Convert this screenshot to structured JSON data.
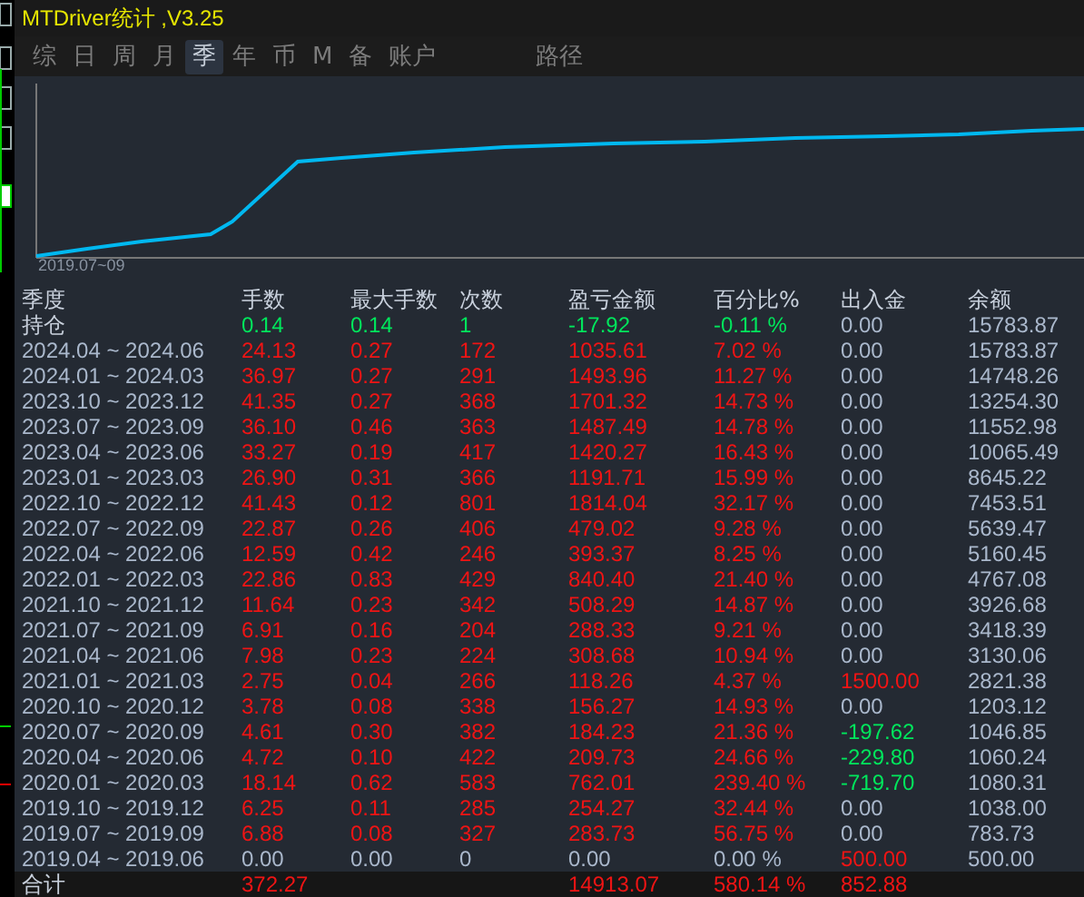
{
  "window": {
    "title": "MTDriver统计 ,V3.25"
  },
  "tabs": [
    {
      "label": "综",
      "selected": false
    },
    {
      "label": "日",
      "selected": false
    },
    {
      "label": "周",
      "selected": false
    },
    {
      "label": "月",
      "selected": false
    },
    {
      "label": "季",
      "selected": true
    },
    {
      "label": "年",
      "selected": false
    },
    {
      "label": "币",
      "selected": false
    },
    {
      "label": "M",
      "selected": false
    },
    {
      "label": "备",
      "selected": false
    },
    {
      "label": "账户",
      "selected": false
    }
  ],
  "path_tab": {
    "label": "路径"
  },
  "chart": {
    "start_label": "2019.07~09"
  },
  "table": {
    "columns": [
      "季度",
      "手数",
      "最大手数",
      "次数",
      "盈亏金额",
      "百分比%",
      "出入金",
      "余额"
    ],
    "rows": [
      [
        {
          "text": "持仓",
          "color": "#c8d0dc"
        },
        {
          "text": "0.14",
          "color": "#00e65c"
        },
        {
          "text": "0.14",
          "color": "#00e65c"
        },
        {
          "text": "1",
          "color": "#00e65c"
        },
        {
          "text": "-17.92",
          "color": "#00e65c"
        },
        {
          "text": "-0.11 %",
          "color": "#00e65c"
        },
        {
          "text": "0.00",
          "color": "#aab8cc"
        },
        {
          "text": "15783.87",
          "color": "#aab8cc"
        }
      ],
      [
        {
          "text": "2024.04 ~ 2024.06",
          "color": "#aab8cc"
        },
        {
          "text": "24.13",
          "color": "#f01414"
        },
        {
          "text": "0.27",
          "color": "#f01414"
        },
        {
          "text": "172",
          "color": "#f01414"
        },
        {
          "text": "1035.61",
          "color": "#f01414"
        },
        {
          "text": "7.02 %",
          "color": "#f01414"
        },
        {
          "text": "0.00",
          "color": "#aab8cc"
        },
        {
          "text": "15783.87",
          "color": "#aab8cc"
        }
      ],
      [
        {
          "text": "2024.01 ~ 2024.03",
          "color": "#aab8cc"
        },
        {
          "text": "36.97",
          "color": "#f01414"
        },
        {
          "text": "0.27",
          "color": "#f01414"
        },
        {
          "text": "291",
          "color": "#f01414"
        },
        {
          "text": "1493.96",
          "color": "#f01414"
        },
        {
          "text": "11.27 %",
          "color": "#f01414"
        },
        {
          "text": "0.00",
          "color": "#aab8cc"
        },
        {
          "text": "14748.26",
          "color": "#aab8cc"
        }
      ],
      [
        {
          "text": "2023.10 ~ 2023.12",
          "color": "#aab8cc"
        },
        {
          "text": "41.35",
          "color": "#f01414"
        },
        {
          "text": "0.27",
          "color": "#f01414"
        },
        {
          "text": "368",
          "color": "#f01414"
        },
        {
          "text": "1701.32",
          "color": "#f01414"
        },
        {
          "text": "14.73 %",
          "color": "#f01414"
        },
        {
          "text": "0.00",
          "color": "#aab8cc"
        },
        {
          "text": "13254.30",
          "color": "#aab8cc"
        }
      ],
      [
        {
          "text": "2023.07 ~ 2023.09",
          "color": "#aab8cc"
        },
        {
          "text": "36.10",
          "color": "#f01414"
        },
        {
          "text": "0.46",
          "color": "#f01414"
        },
        {
          "text": "363",
          "color": "#f01414"
        },
        {
          "text": "1487.49",
          "color": "#f01414"
        },
        {
          "text": "14.78 %",
          "color": "#f01414"
        },
        {
          "text": "0.00",
          "color": "#aab8cc"
        },
        {
          "text": "11552.98",
          "color": "#aab8cc"
        }
      ],
      [
        {
          "text": "2023.04 ~ 2023.06",
          "color": "#aab8cc"
        },
        {
          "text": "33.27",
          "color": "#f01414"
        },
        {
          "text": "0.19",
          "color": "#f01414"
        },
        {
          "text": "417",
          "color": "#f01414"
        },
        {
          "text": "1420.27",
          "color": "#f01414"
        },
        {
          "text": "16.43 %",
          "color": "#f01414"
        },
        {
          "text": "0.00",
          "color": "#aab8cc"
        },
        {
          "text": "10065.49",
          "color": "#aab8cc"
        }
      ],
      [
        {
          "text": "2023.01 ~ 2023.03",
          "color": "#aab8cc"
        },
        {
          "text": "26.90",
          "color": "#f01414"
        },
        {
          "text": "0.31",
          "color": "#f01414"
        },
        {
          "text": "366",
          "color": "#f01414"
        },
        {
          "text": "1191.71",
          "color": "#f01414"
        },
        {
          "text": "15.99 %",
          "color": "#f01414"
        },
        {
          "text": "0.00",
          "color": "#aab8cc"
        },
        {
          "text": "8645.22",
          "color": "#aab8cc"
        }
      ],
      [
        {
          "text": "2022.10 ~ 2022.12",
          "color": "#aab8cc"
        },
        {
          "text": "41.43",
          "color": "#f01414"
        },
        {
          "text": "0.12",
          "color": "#f01414"
        },
        {
          "text": "801",
          "color": "#f01414"
        },
        {
          "text": "1814.04",
          "color": "#f01414"
        },
        {
          "text": "32.17 %",
          "color": "#f01414"
        },
        {
          "text": "0.00",
          "color": "#aab8cc"
        },
        {
          "text": "7453.51",
          "color": "#aab8cc"
        }
      ],
      [
        {
          "text": "2022.07 ~ 2022.09",
          "color": "#aab8cc"
        },
        {
          "text": "22.87",
          "color": "#f01414"
        },
        {
          "text": "0.26",
          "color": "#f01414"
        },
        {
          "text": "406",
          "color": "#f01414"
        },
        {
          "text": "479.02",
          "color": "#f01414"
        },
        {
          "text": "9.28 %",
          "color": "#f01414"
        },
        {
          "text": "0.00",
          "color": "#aab8cc"
        },
        {
          "text": "5639.47",
          "color": "#aab8cc"
        }
      ],
      [
        {
          "text": "2022.04 ~ 2022.06",
          "color": "#aab8cc"
        },
        {
          "text": "12.59",
          "color": "#f01414"
        },
        {
          "text": "0.42",
          "color": "#f01414"
        },
        {
          "text": "246",
          "color": "#f01414"
        },
        {
          "text": "393.37",
          "color": "#f01414"
        },
        {
          "text": "8.25 %",
          "color": "#f01414"
        },
        {
          "text": "0.00",
          "color": "#aab8cc"
        },
        {
          "text": "5160.45",
          "color": "#aab8cc"
        }
      ],
      [
        {
          "text": "2022.01 ~ 2022.03",
          "color": "#aab8cc"
        },
        {
          "text": "22.86",
          "color": "#f01414"
        },
        {
          "text": "0.83",
          "color": "#f01414"
        },
        {
          "text": "429",
          "color": "#f01414"
        },
        {
          "text": "840.40",
          "color": "#f01414"
        },
        {
          "text": "21.40 %",
          "color": "#f01414"
        },
        {
          "text": "0.00",
          "color": "#aab8cc"
        },
        {
          "text": "4767.08",
          "color": "#aab8cc"
        }
      ],
      [
        {
          "text": "2021.10 ~ 2021.12",
          "color": "#aab8cc"
        },
        {
          "text": "11.64",
          "color": "#f01414"
        },
        {
          "text": "0.23",
          "color": "#f01414"
        },
        {
          "text": "342",
          "color": "#f01414"
        },
        {
          "text": "508.29",
          "color": "#f01414"
        },
        {
          "text": "14.87 %",
          "color": "#f01414"
        },
        {
          "text": "0.00",
          "color": "#aab8cc"
        },
        {
          "text": "3926.68",
          "color": "#aab8cc"
        }
      ],
      [
        {
          "text": "2021.07 ~ 2021.09",
          "color": "#aab8cc"
        },
        {
          "text": "6.91",
          "color": "#f01414"
        },
        {
          "text": "0.16",
          "color": "#f01414"
        },
        {
          "text": "204",
          "color": "#f01414"
        },
        {
          "text": "288.33",
          "color": "#f01414"
        },
        {
          "text": "9.21 %",
          "color": "#f01414"
        },
        {
          "text": "0.00",
          "color": "#aab8cc"
        },
        {
          "text": "3418.39",
          "color": "#aab8cc"
        }
      ],
      [
        {
          "text": "2021.04 ~ 2021.06",
          "color": "#aab8cc"
        },
        {
          "text": "7.98",
          "color": "#f01414"
        },
        {
          "text": "0.23",
          "color": "#f01414"
        },
        {
          "text": "224",
          "color": "#f01414"
        },
        {
          "text": "308.68",
          "color": "#f01414"
        },
        {
          "text": "10.94 %",
          "color": "#f01414"
        },
        {
          "text": "0.00",
          "color": "#aab8cc"
        },
        {
          "text": "3130.06",
          "color": "#aab8cc"
        }
      ],
      [
        {
          "text": "2021.01 ~ 2021.03",
          "color": "#aab8cc"
        },
        {
          "text": "2.75",
          "color": "#f01414"
        },
        {
          "text": "0.04",
          "color": "#f01414"
        },
        {
          "text": "266",
          "color": "#f01414"
        },
        {
          "text": "118.26",
          "color": "#f01414"
        },
        {
          "text": "4.37 %",
          "color": "#f01414"
        },
        {
          "text": "1500.00",
          "color": "#f01414"
        },
        {
          "text": "2821.38",
          "color": "#aab8cc"
        }
      ],
      [
        {
          "text": "2020.10 ~ 2020.12",
          "color": "#aab8cc"
        },
        {
          "text": "3.78",
          "color": "#f01414"
        },
        {
          "text": "0.08",
          "color": "#f01414"
        },
        {
          "text": "338",
          "color": "#f01414"
        },
        {
          "text": "156.27",
          "color": "#f01414"
        },
        {
          "text": "14.93 %",
          "color": "#f01414"
        },
        {
          "text": "0.00",
          "color": "#aab8cc"
        },
        {
          "text": "1203.12",
          "color": "#aab8cc"
        }
      ],
      [
        {
          "text": "2020.07 ~ 2020.09",
          "color": "#aab8cc"
        },
        {
          "text": "4.61",
          "color": "#f01414"
        },
        {
          "text": "0.30",
          "color": "#f01414"
        },
        {
          "text": "382",
          "color": "#f01414"
        },
        {
          "text": "184.23",
          "color": "#f01414"
        },
        {
          "text": "21.36 %",
          "color": "#f01414"
        },
        {
          "text": "-197.62",
          "color": "#00e65c"
        },
        {
          "text": "1046.85",
          "color": "#aab8cc"
        }
      ],
      [
        {
          "text": "2020.04 ~ 2020.06",
          "color": "#aab8cc"
        },
        {
          "text": "4.72",
          "color": "#f01414"
        },
        {
          "text": "0.10",
          "color": "#f01414"
        },
        {
          "text": "422",
          "color": "#f01414"
        },
        {
          "text": "209.73",
          "color": "#f01414"
        },
        {
          "text": "24.66 %",
          "color": "#f01414"
        },
        {
          "text": "-229.80",
          "color": "#00e65c"
        },
        {
          "text": "1060.24",
          "color": "#aab8cc"
        }
      ],
      [
        {
          "text": "2020.01 ~ 2020.03",
          "color": "#aab8cc"
        },
        {
          "text": "18.14",
          "color": "#f01414"
        },
        {
          "text": "0.62",
          "color": "#f01414"
        },
        {
          "text": "583",
          "color": "#f01414"
        },
        {
          "text": "762.01",
          "color": "#f01414"
        },
        {
          "text": "239.40 %",
          "color": "#f01414"
        },
        {
          "text": "-719.70",
          "color": "#00e65c"
        },
        {
          "text": "1080.31",
          "color": "#aab8cc"
        }
      ],
      [
        {
          "text": "2019.10 ~ 2019.12",
          "color": "#aab8cc"
        },
        {
          "text": "6.25",
          "color": "#f01414"
        },
        {
          "text": "0.11",
          "color": "#f01414"
        },
        {
          "text": "285",
          "color": "#f01414"
        },
        {
          "text": "254.27",
          "color": "#f01414"
        },
        {
          "text": "32.44 %",
          "color": "#f01414"
        },
        {
          "text": "0.00",
          "color": "#aab8cc"
        },
        {
          "text": "1038.00",
          "color": "#aab8cc"
        }
      ],
      [
        {
          "text": "2019.07 ~ 2019.09",
          "color": "#aab8cc"
        },
        {
          "text": "6.88",
          "color": "#f01414"
        },
        {
          "text": "0.08",
          "color": "#f01414"
        },
        {
          "text": "327",
          "color": "#f01414"
        },
        {
          "text": "283.73",
          "color": "#f01414"
        },
        {
          "text": "56.75 %",
          "color": "#f01414"
        },
        {
          "text": "0.00",
          "color": "#aab8cc"
        },
        {
          "text": "783.73",
          "color": "#aab8cc"
        }
      ],
      [
        {
          "text": "2019.04 ~ 2019.06",
          "color": "#aab8cc"
        },
        {
          "text": "0.00",
          "color": "#aab8cc"
        },
        {
          "text": "0.00",
          "color": "#aab8cc"
        },
        {
          "text": "0",
          "color": "#aab8cc"
        },
        {
          "text": "0.00",
          "color": "#aab8cc"
        },
        {
          "text": "0.00 %",
          "color": "#aab8cc"
        },
        {
          "text": "500.00",
          "color": "#f01414"
        },
        {
          "text": "500.00",
          "color": "#aab8cc"
        }
      ]
    ],
    "total": {
      "label": {
        "text": "合计",
        "color": "#c8d0dc"
      },
      "lots": {
        "text": "372.27",
        "color": "#f01414"
      },
      "profit": {
        "text": "14913.07",
        "color": "#f01414"
      },
      "percent": {
        "text": "580.14 %",
        "color": "#f01414"
      },
      "deposits": {
        "text": "852.88",
        "color": "#f01414"
      }
    }
  }
}
